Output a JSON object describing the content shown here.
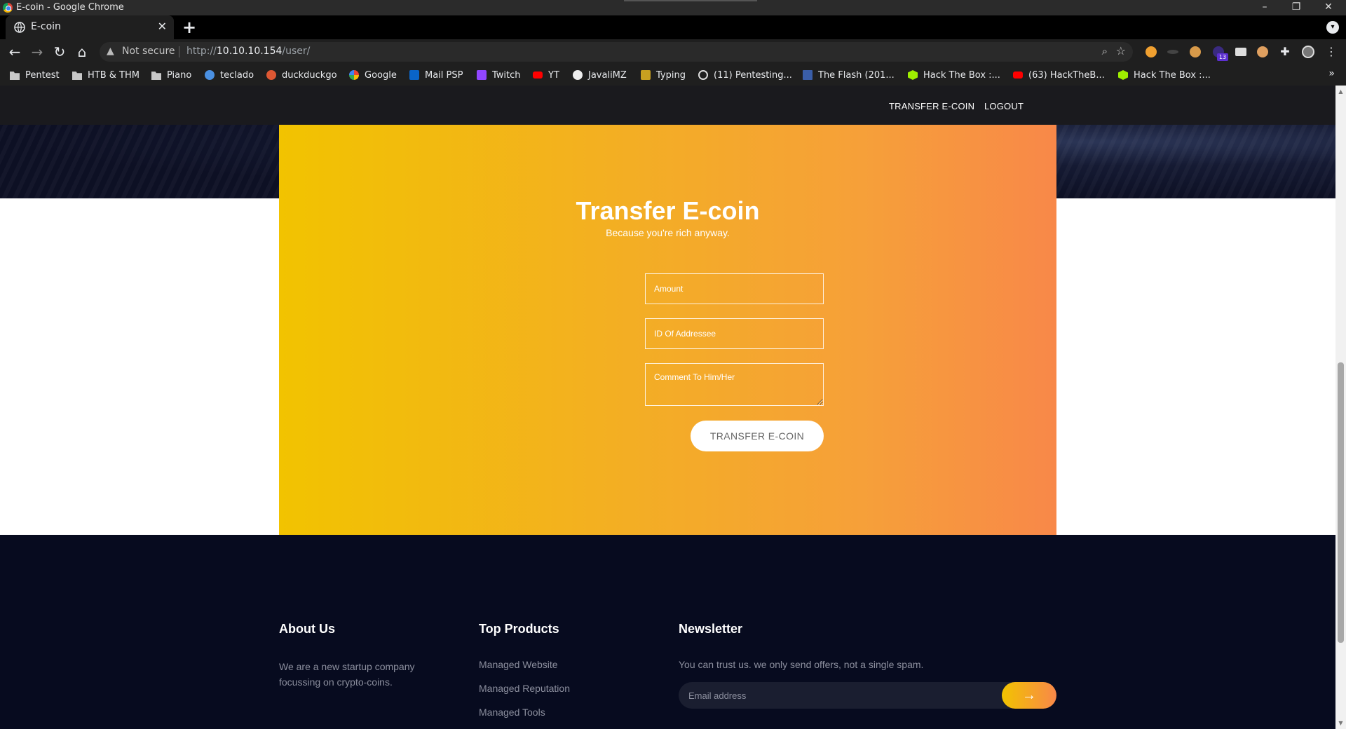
{
  "window": {
    "title": "E-coin - Google Chrome"
  },
  "tab": {
    "title": "E-coin"
  },
  "address": {
    "security_label": "Not secure",
    "url_prefix": "http://",
    "url_host": "10.10.10.154",
    "url_path": "/user/"
  },
  "extensions": {
    "badge_count": "13"
  },
  "bookmarks": [
    {
      "label": "Pentest",
      "icon": "folder-icon"
    },
    {
      "label": "HTB & THM",
      "icon": "folder-icon"
    },
    {
      "label": "Piano",
      "icon": "folder-icon"
    },
    {
      "label": "teclado",
      "icon": "site-icon"
    },
    {
      "label": "duckduckgo",
      "icon": "duckduckgo-icon"
    },
    {
      "label": "Google",
      "icon": "google-icon"
    },
    {
      "label": "Mail PSP",
      "icon": "outlook-icon"
    },
    {
      "label": "Twitch",
      "icon": "twitch-icon"
    },
    {
      "label": "YT",
      "icon": "youtube-icon"
    },
    {
      "label": "JavaliMZ",
      "icon": "github-icon"
    },
    {
      "label": "Typing",
      "icon": "typing-icon"
    },
    {
      "label": "(11) Pentesting...",
      "icon": "globe-icon"
    },
    {
      "label": "The Flash (201...",
      "icon": "film-icon"
    },
    {
      "label": "Hack The Box :...",
      "icon": "htb-icon"
    },
    {
      "label": "(63) HackTheB...",
      "icon": "youtube-icon"
    },
    {
      "label": "Hack The Box :...",
      "icon": "htb-icon"
    }
  ],
  "nav": {
    "transfer": "TRANSFER E-COIN",
    "logout": "LOGOUT"
  },
  "transfer": {
    "title": "Transfer E-coin",
    "subtitle": "Because you're rich anyway.",
    "amount_placeholder": "Amount",
    "addressee_placeholder": "ID Of Addressee",
    "comment_placeholder": "Comment To Him/Her",
    "submit_label": "TRANSFER E-COIN"
  },
  "footer": {
    "about": {
      "title": "About Us",
      "text": "We are a new startup company focussing on crypto-coins."
    },
    "products": {
      "title": "Top Products",
      "links": [
        "Managed Website",
        "Managed Reputation",
        "Managed Tools"
      ]
    },
    "newsletter": {
      "title": "Newsletter",
      "text": "You can trust us. we only send offers, not a single spam.",
      "email_placeholder": "Email address"
    }
  },
  "colors": {
    "accent_start": "#f2c300",
    "accent_end": "#f88849",
    "footer_bg": "#070b1f"
  }
}
